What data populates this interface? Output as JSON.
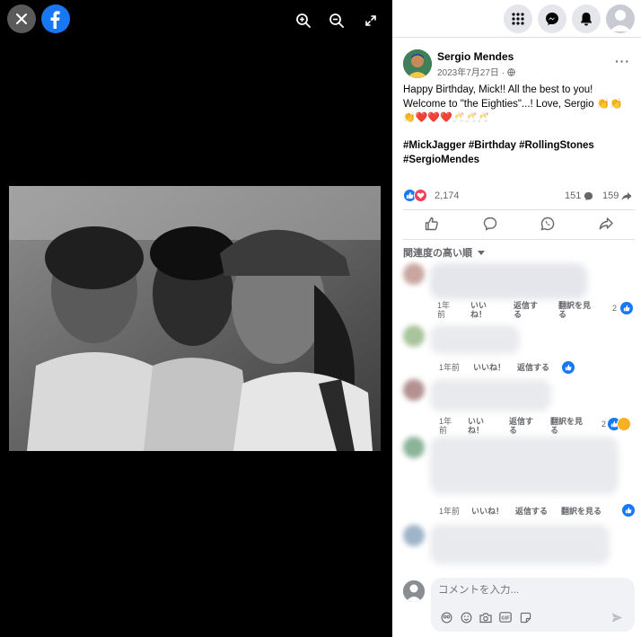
{
  "viewer": {
    "close_icon": "close-icon",
    "logo_icon": "facebook-logo-icon",
    "zoom_in_icon": "zoom-in-icon",
    "zoom_out_icon": "zoom-out-icon",
    "fullscreen_icon": "fullscreen-icon",
    "photo_icon": "photo-image"
  },
  "topbar": {
    "menu_icon": "menu-grid-icon",
    "messenger_icon": "messenger-icon",
    "notifications_icon": "bell-icon"
  },
  "post": {
    "author": "Sergio Mendes",
    "date": "2023年7月27日 · ",
    "text": "Happy Birthday, Mick!! All the best to you! Welcome to \"the Eighties\"...! Love, Sergio 👏👏",
    "emoji_line": "👏❤️❤️❤️🥂🥂🥂",
    "hashtags": "#MickJagger #Birthday #RollingStones #SergioMendes",
    "more": "···"
  },
  "reactions": {
    "count": "2,174",
    "comments": "151",
    "shares": "159",
    "like_color": "#1877f2",
    "love_color": "#f33e58"
  },
  "sort": {
    "label": "関連度の高い順"
  },
  "comments": [
    {
      "time": "1年\n前",
      "like": "いい\nね！",
      "reply": "返信す\nる",
      "translate": "翻訳を見\nる",
      "count": "2"
    },
    {
      "time": "1年前",
      "like": "いいね！",
      "reply": "返信する"
    },
    {
      "time": "1年\n前",
      "like": "いい\nね！",
      "reply": "返信す\nる",
      "translate": "翻訳を見\nる",
      "count": "2"
    },
    {
      "time": "1年前",
      "like": "いいね！",
      "reply": "返信する",
      "translate": "翻訳を見る"
    }
  ],
  "composer": {
    "placeholder": "コメントを入力..."
  }
}
